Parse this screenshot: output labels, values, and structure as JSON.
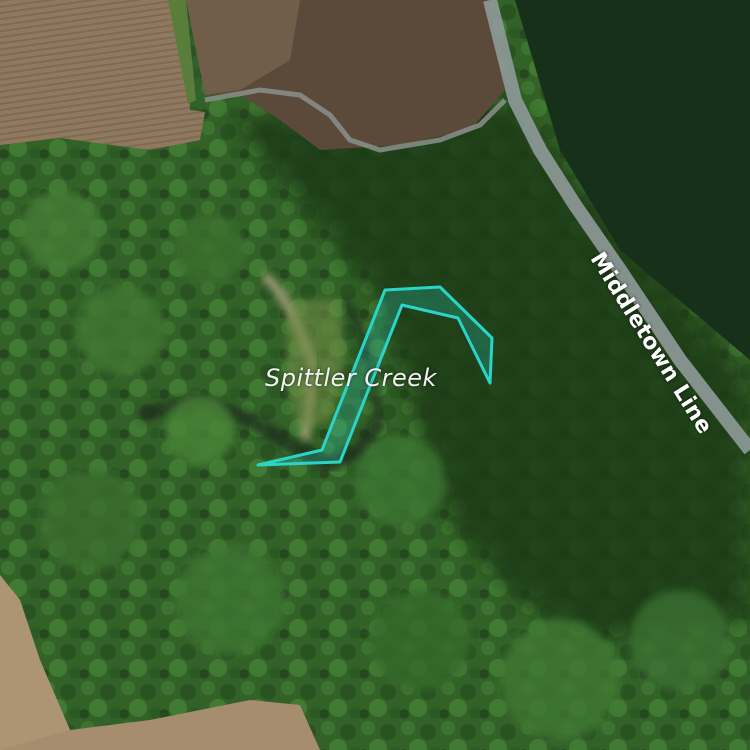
{
  "map": {
    "view": "satellite",
    "labels": {
      "creek_name": "Spittler Creek",
      "road_name": "Middletown Line"
    },
    "highlight": {
      "feature": "creek-segment",
      "color": "#2ad4c9"
    },
    "colors": {
      "forest": "#2f5d27",
      "field": "#8a7258",
      "road": "#9aa3a3",
      "water_shadow": "#1a2a1c"
    }
  }
}
